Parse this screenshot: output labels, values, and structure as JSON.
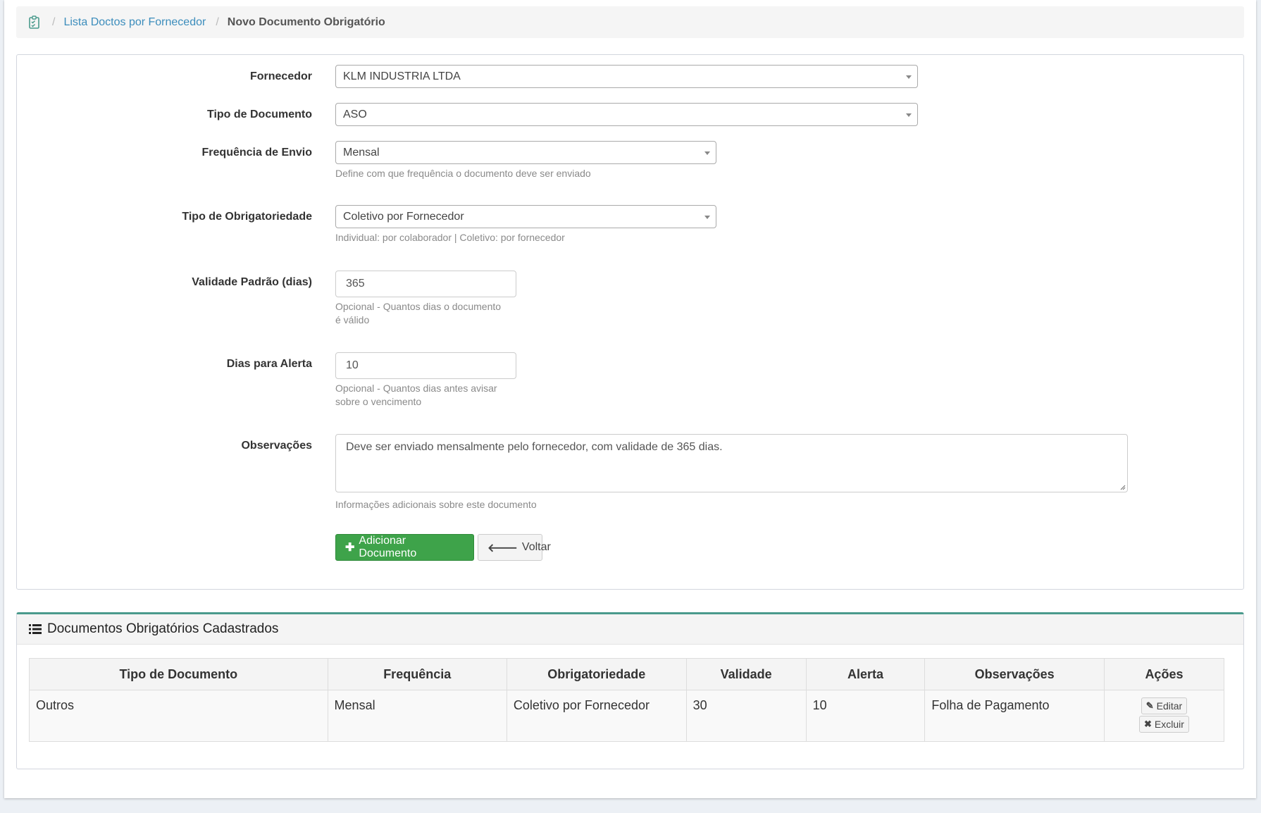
{
  "breadcrumb": {
    "icon": "checklist-document-icon",
    "link": "Lista Doctos por Fornecedor",
    "current": "Novo Documento Obrigatório"
  },
  "form": {
    "fornecedor": {
      "label": "Fornecedor",
      "value": "KLM INDUSTRIA LTDA"
    },
    "tipo_documento": {
      "label": "Tipo de Documento",
      "value": "ASO"
    },
    "frequencia": {
      "label": "Frequência de Envio",
      "value": "Mensal",
      "help": "Define com que frequência o documento deve ser enviado"
    },
    "obrigatoriedade": {
      "label": "Tipo de Obrigatoriedade",
      "value": "Coletivo por Fornecedor",
      "help": "Individual: por colaborador | Coletivo: por fornecedor"
    },
    "validade": {
      "label": "Validade Padrão (dias)",
      "value": "365",
      "help_line1": "Opcional - Quantos dias o documento",
      "help_line2": "é válido"
    },
    "alerta": {
      "label": "Dias para Alerta",
      "value": "10",
      "help_line1": "Opcional - Quantos dias antes avisar",
      "help_line2": "sobre o vencimento"
    },
    "observacoes": {
      "label": "Observações",
      "value": "Deve ser enviado mensalmente pelo fornecedor, com validade de 365 dias.",
      "help": "Informações adicionais sobre este documento"
    },
    "submit_label": "Adicionar Documento",
    "back_label": "Voltar"
  },
  "list": {
    "title": "Documentos Obrigatórios Cadastrados",
    "columns": [
      "Tipo de Documento",
      "Frequência",
      "Obrigatoriedade",
      "Validade",
      "Alerta",
      "Observações",
      "Ações"
    ],
    "rows": [
      {
        "tipo": "Outros",
        "frequencia": "Mensal",
        "obrigatoriedade": "Coletivo por Fornecedor",
        "validade": "30",
        "alerta": "10",
        "observacoes": "Folha de Pagamento",
        "edit_label": "Editar",
        "delete_label": "Excluir"
      }
    ]
  },
  "colors": {
    "primary_link": "#3c8dbc",
    "success": "#3ea34a",
    "box_accent": "#4a9a8c"
  }
}
